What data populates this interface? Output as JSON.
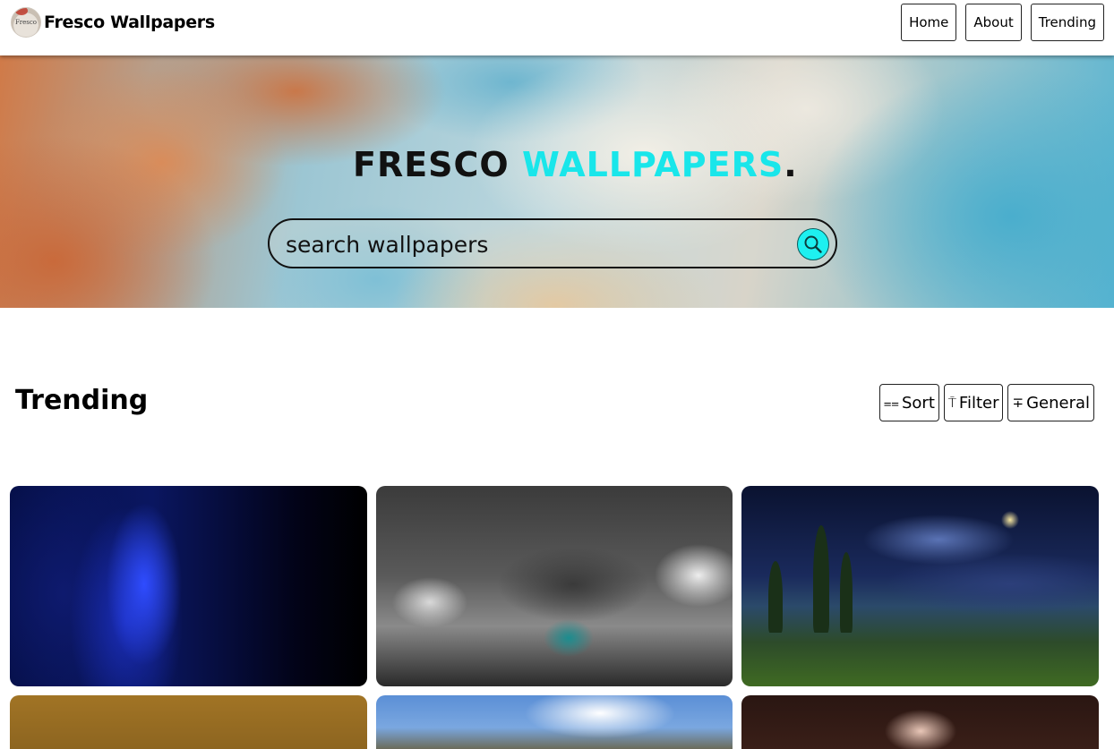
{
  "header": {
    "brand_name": "Fresco Wallpapers",
    "logo_text": "Fresco",
    "nav": [
      "Home",
      "About",
      "Trending"
    ]
  },
  "hero": {
    "title_part1": "FRESCO",
    "title_part2": "WALLPAPERS",
    "title_part3": ".",
    "search_placeholder": "search wallpapers",
    "accent_color": "#19e6ea"
  },
  "section": {
    "title": "Trending",
    "tools": [
      {
        "icon": "sort-icon",
        "glyph": "⩵",
        "label": " Sort"
      },
      {
        "icon": "umbrella-icon",
        "glyph": "⍑",
        "label": "Filter"
      },
      {
        "icon": "general-icon",
        "glyph": "∓",
        "label": "General"
      }
    ]
  },
  "wallpapers": [
    {
      "name": "starry-night-sky"
    },
    {
      "name": "abstract-monochrome-mech"
    },
    {
      "name": "night-landscape-moon"
    },
    {
      "name": "golden-gradient"
    },
    {
      "name": "mountain-clouds"
    },
    {
      "name": "anime-character"
    }
  ]
}
